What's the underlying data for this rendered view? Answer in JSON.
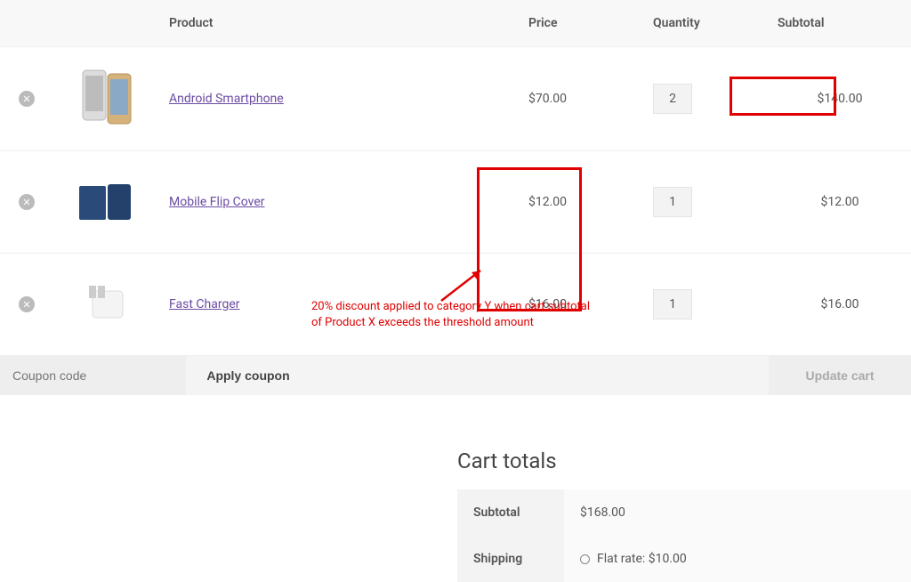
{
  "headers": {
    "product": "Product",
    "price": "Price",
    "qty": "Quantity",
    "subtotal": "Subtotal"
  },
  "rows": [
    {
      "name": "Android Smartphone",
      "price": "$70.00",
      "qty": "2",
      "subtotal": "$140.00"
    },
    {
      "name": "Mobile Flip Cover",
      "price": "$12.00",
      "qty": "1",
      "subtotal": "$12.00"
    },
    {
      "name": "Fast Charger",
      "price": "$16.00",
      "qty": "1",
      "subtotal": "$16.00"
    }
  ],
  "coupon": {
    "placeholder": "Coupon code",
    "apply": "Apply coupon",
    "update": "Update cart"
  },
  "annotation": "20% discount applied  to category Y when cart subtotal of Product X exceeds the threshold amount",
  "totals": {
    "title": "Cart totals",
    "subtotal_label": "Subtotal",
    "subtotal_value": "$168.00",
    "shipping_label": "Shipping",
    "shipping_option": "Flat rate: $10.00"
  }
}
